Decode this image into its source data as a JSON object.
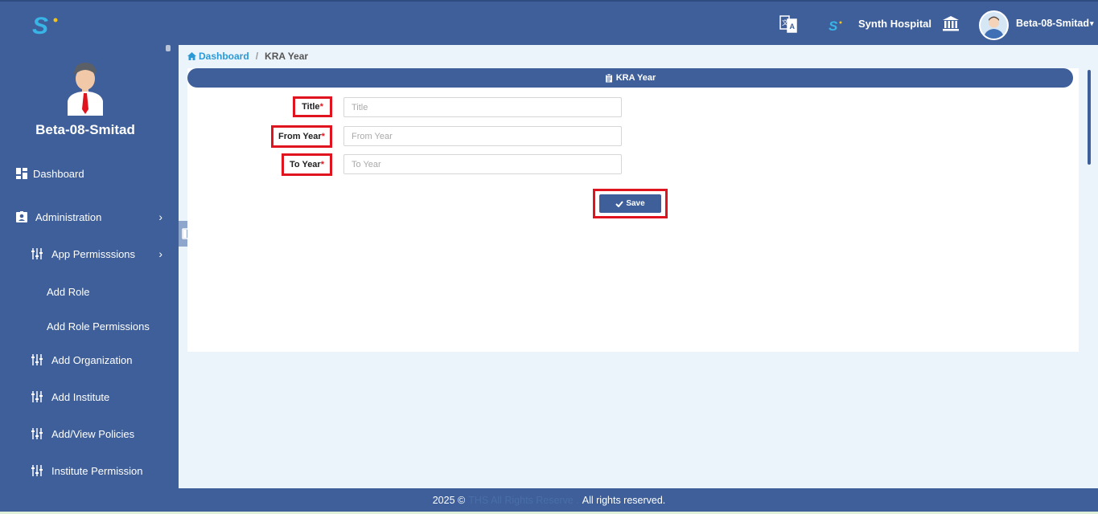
{
  "topbar": {
    "hospital_name": "Synth Hospital",
    "user_name": "Beta-08-Smitad",
    "icons": [
      "logo-icon",
      "translate-icon",
      "brand-mini-icon",
      "bank-icon",
      "avatar"
    ]
  },
  "sidebar": {
    "user_name": "Beta-08-Smitad",
    "items": [
      {
        "label": "Dashboard",
        "icon": "dashboard-icon"
      },
      {
        "label": "Administration",
        "icon": "id-card-icon"
      },
      {
        "label": "App Permisssions",
        "icon": "sliders-icon"
      },
      {
        "label": "Add Role",
        "icon": ""
      },
      {
        "label": "Add Role Permissions",
        "icon": ""
      },
      {
        "label": "Add Organization",
        "icon": "sliders-icon"
      },
      {
        "label": "Add Institute",
        "icon": "sliders-icon"
      },
      {
        "label": "Add/View Policies",
        "icon": "sliders-icon"
      },
      {
        "label": "Institute Permission",
        "icon": "sliders-icon"
      }
    ]
  },
  "breadcrumb": {
    "home": "Dashboard",
    "separator": "/",
    "current": "KRA Year"
  },
  "card": {
    "header": "KRA Year"
  },
  "form": {
    "title_label": "Title",
    "title_placeholder": "Title",
    "title_value": "",
    "from_label": "From Year",
    "from_placeholder": "From Year",
    "from_value": "",
    "to_label": "To Year",
    "to_placeholder": "To Year",
    "to_value": "",
    "required_mark": "*",
    "save_label": "Save"
  },
  "footer": {
    "prefix": "2025 ©",
    "brand": "THS All Rights Reserve .",
    "suffix": "All rights reserved."
  },
  "colors": {
    "primary": "#3e5f99",
    "highlight": "#e0141e",
    "link": "#2a9ad6",
    "background": "#ecf4fb"
  }
}
